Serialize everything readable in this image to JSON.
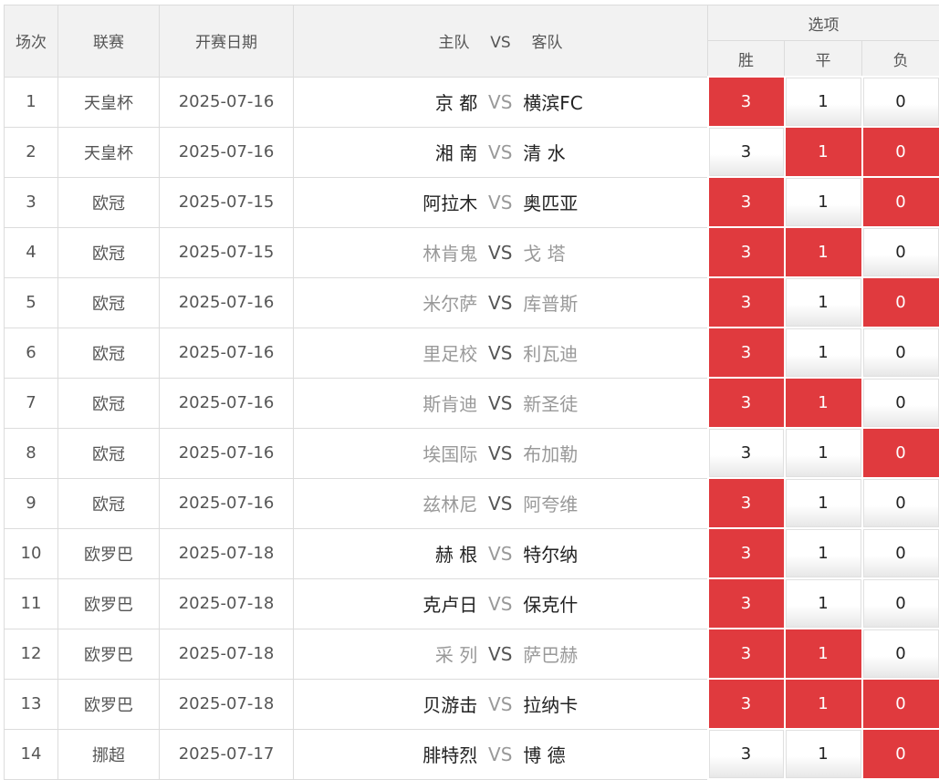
{
  "header": {
    "col_num": "场次",
    "col_league": "联赛",
    "col_date": "开赛日期",
    "col_home": "主队",
    "col_vs": "VS",
    "col_away": "客队",
    "col_options": "选项",
    "opt_win": "胜",
    "opt_draw": "平",
    "opt_lose": "负"
  },
  "colors": {
    "selected": "#e03a3e",
    "header_bg": "#f2f2f2"
  },
  "rows": [
    {
      "num": "1",
      "league": "天皇杯",
      "date": "2025-07-16",
      "home": "京 都",
      "vs": "VS",
      "away": "横滨FC",
      "dark": true,
      "w": "3",
      "d": "1",
      "l": "0",
      "sel": [
        true,
        false,
        false
      ]
    },
    {
      "num": "2",
      "league": "天皇杯",
      "date": "2025-07-16",
      "home": "湘 南",
      "vs": "VS",
      "away": "清 水",
      "dark": true,
      "w": "3",
      "d": "1",
      "l": "0",
      "sel": [
        false,
        true,
        true
      ]
    },
    {
      "num": "3",
      "league": "欧冠",
      "date": "2025-07-15",
      "home": "阿拉木",
      "vs": "VS",
      "away": "奥匹亚",
      "dark": true,
      "w": "3",
      "d": "1",
      "l": "0",
      "sel": [
        true,
        false,
        true
      ]
    },
    {
      "num": "4",
      "league": "欧冠",
      "date": "2025-07-15",
      "home": "林肯鬼",
      "vs": "VS",
      "away": "戈 塔",
      "dark": false,
      "w": "3",
      "d": "1",
      "l": "0",
      "sel": [
        true,
        true,
        false
      ]
    },
    {
      "num": "5",
      "league": "欧冠",
      "date": "2025-07-16",
      "home": "米尔萨",
      "vs": "VS",
      "away": "库普斯",
      "dark": false,
      "w": "3",
      "d": "1",
      "l": "0",
      "sel": [
        true,
        false,
        true
      ]
    },
    {
      "num": "6",
      "league": "欧冠",
      "date": "2025-07-16",
      "home": "里足校",
      "vs": "VS",
      "away": "利瓦迪",
      "dark": false,
      "w": "3",
      "d": "1",
      "l": "0",
      "sel": [
        true,
        false,
        false
      ]
    },
    {
      "num": "7",
      "league": "欧冠",
      "date": "2025-07-16",
      "home": "斯肯迪",
      "vs": "VS",
      "away": "新圣徒",
      "dark": false,
      "w": "3",
      "d": "1",
      "l": "0",
      "sel": [
        true,
        true,
        false
      ]
    },
    {
      "num": "8",
      "league": "欧冠",
      "date": "2025-07-16",
      "home": "埃国际",
      "vs": "VS",
      "away": "布加勒",
      "dark": false,
      "w": "3",
      "d": "1",
      "l": "0",
      "sel": [
        false,
        false,
        true
      ]
    },
    {
      "num": "9",
      "league": "欧冠",
      "date": "2025-07-16",
      "home": "兹林尼",
      "vs": "VS",
      "away": "阿夸维",
      "dark": false,
      "w": "3",
      "d": "1",
      "l": "0",
      "sel": [
        true,
        false,
        false
      ]
    },
    {
      "num": "10",
      "league": "欧罗巴",
      "date": "2025-07-18",
      "home": "赫 根",
      "vs": "VS",
      "away": "特尔纳",
      "dark": true,
      "w": "3",
      "d": "1",
      "l": "0",
      "sel": [
        true,
        false,
        false
      ]
    },
    {
      "num": "11",
      "league": "欧罗巴",
      "date": "2025-07-18",
      "home": "克卢日",
      "vs": "VS",
      "away": "保克什",
      "dark": true,
      "w": "3",
      "d": "1",
      "l": "0",
      "sel": [
        true,
        false,
        false
      ]
    },
    {
      "num": "12",
      "league": "欧罗巴",
      "date": "2025-07-18",
      "home": "采 列",
      "vs": "VS",
      "away": "萨巴赫",
      "dark": false,
      "w": "3",
      "d": "1",
      "l": "0",
      "sel": [
        true,
        true,
        false
      ]
    },
    {
      "num": "13",
      "league": "欧罗巴",
      "date": "2025-07-18",
      "home": "贝游击",
      "vs": "VS",
      "away": "拉纳卡",
      "dark": true,
      "w": "3",
      "d": "1",
      "l": "0",
      "sel": [
        true,
        true,
        true
      ]
    },
    {
      "num": "14",
      "league": "挪超",
      "date": "2025-07-17",
      "home": "腓特烈",
      "vs": "VS",
      "away": "博 德",
      "dark": true,
      "w": "3",
      "d": "1",
      "l": "0",
      "sel": [
        false,
        false,
        true
      ]
    }
  ]
}
